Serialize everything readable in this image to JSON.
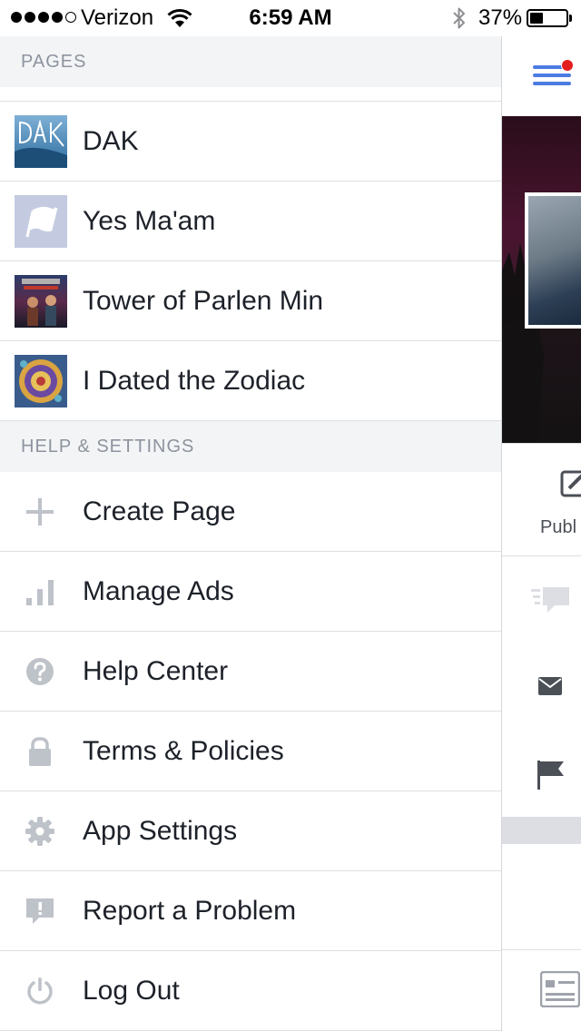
{
  "status_bar": {
    "carrier": "Verizon",
    "time": "6:59 AM",
    "battery_percent": "37%",
    "battery_level": 0.37,
    "signal_bars": 4
  },
  "menu": {
    "pages_header": "PAGES",
    "pages": [
      {
        "label": "DAK",
        "thumb": "dak-cover"
      },
      {
        "label": "Yes Ma'am",
        "thumb": "flag-placeholder"
      },
      {
        "label": "Tower of Parlen Min",
        "thumb": "book-cover"
      },
      {
        "label": "I Dated the Zodiac",
        "thumb": "zodiac-cover"
      }
    ],
    "help_header": "HELP & SETTINGS",
    "settings": [
      {
        "label": "Create Page",
        "icon": "plus-icon"
      },
      {
        "label": "Manage Ads",
        "icon": "bar-chart-icon"
      },
      {
        "label": "Help Center",
        "icon": "question-icon"
      },
      {
        "label": "Terms & Policies",
        "icon": "lock-icon"
      },
      {
        "label": "App Settings",
        "icon": "gear-icon"
      },
      {
        "label": "Report a Problem",
        "icon": "report-icon"
      },
      {
        "label": "Log Out",
        "icon": "power-icon"
      }
    ]
  },
  "background_page": {
    "publish_label": "Publ",
    "menu_has_notification": true
  },
  "colors": {
    "accent": "#4a7ce2",
    "notification": "#e41e1e",
    "icon_gray": "#bec2c9",
    "text": "#1d2129",
    "section_text": "#8d949e"
  }
}
